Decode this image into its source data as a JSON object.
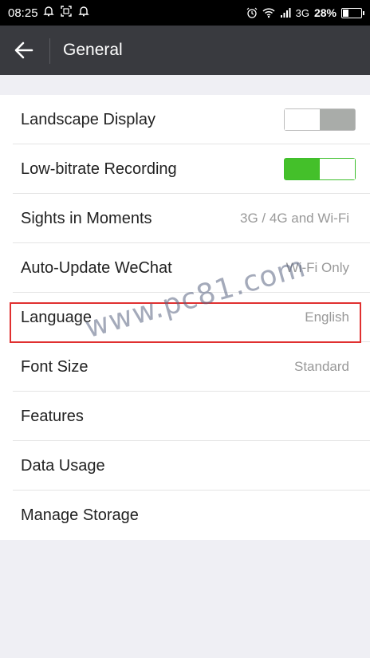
{
  "status_bar": {
    "time": "08:25",
    "network": "3G",
    "battery": "28%"
  },
  "header": {
    "title": "General"
  },
  "settings": [
    {
      "label": "Landscape Display",
      "type": "toggle",
      "on": false
    },
    {
      "label": "Low-bitrate Recording",
      "type": "toggle",
      "on": true
    },
    {
      "label": "Sights in Moments",
      "value": "3G / 4G and Wi-Fi"
    },
    {
      "label": "Auto-Update WeChat",
      "value": "Wi-Fi Only"
    },
    {
      "label": "Language",
      "value": "English"
    },
    {
      "label": "Font Size",
      "value": "Standard"
    },
    {
      "label": "Features"
    },
    {
      "label": "Data Usage"
    },
    {
      "label": "Manage Storage"
    }
  ],
  "watermark": "www.pc81.com",
  "colors": {
    "header_bg": "#393a3f",
    "toggle_on": "#44c02a",
    "highlight": "#e03030"
  }
}
